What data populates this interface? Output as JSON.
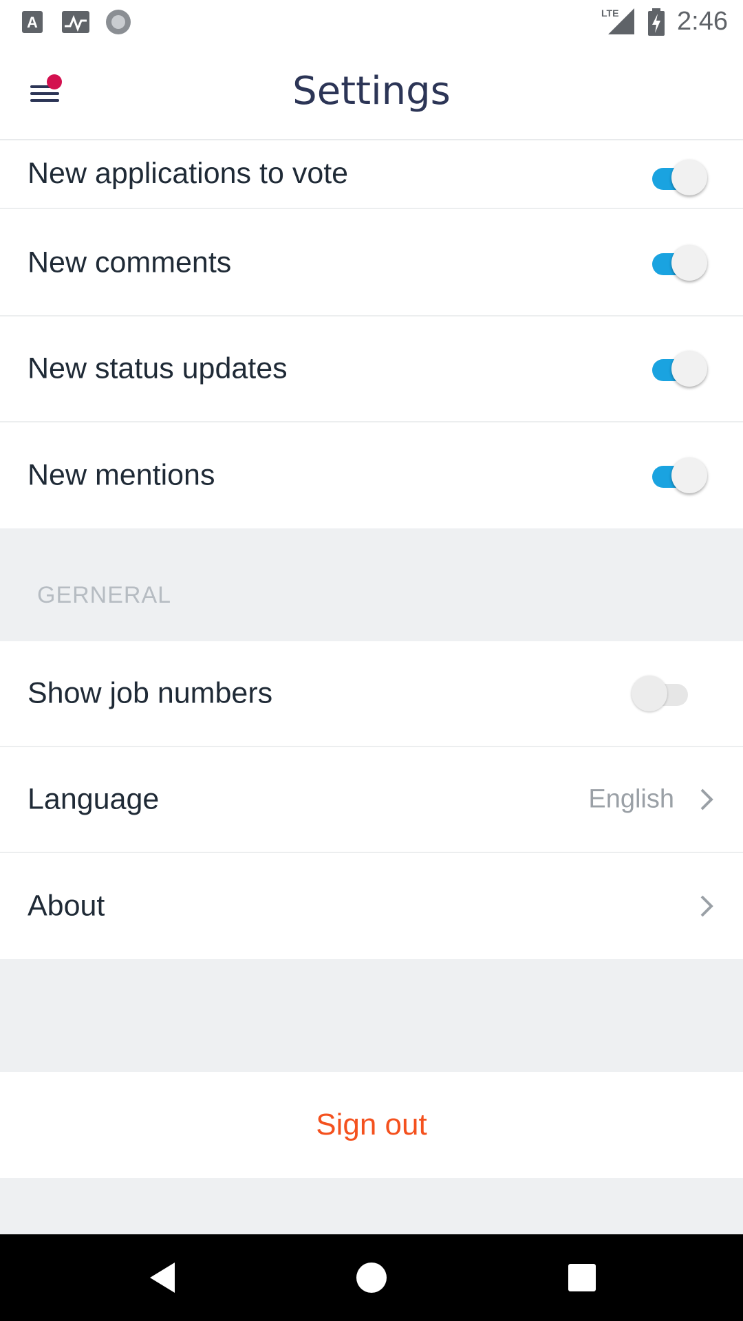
{
  "status_bar": {
    "time": "2:46",
    "network": "LTE",
    "left_icons": [
      "text-a-icon",
      "activity-icon",
      "record-icon"
    ],
    "right_icons": [
      "lte-signal-icon",
      "battery-charging-icon"
    ]
  },
  "app_bar": {
    "title": "Settings",
    "menu_icon": "hamburger-menu-icon",
    "notification_dot_color": "#d3104f"
  },
  "notifications": [
    {
      "label": "New applications to vote",
      "enabled": true
    },
    {
      "label": "New comments",
      "enabled": true
    },
    {
      "label": "New status updates",
      "enabled": true
    },
    {
      "label": "New mentions",
      "enabled": true
    }
  ],
  "general": {
    "header": "GERNERAL",
    "show_job_numbers": {
      "label": "Show job numbers",
      "enabled": false
    },
    "language": {
      "label": "Language",
      "value": "English"
    },
    "about": {
      "label": "About"
    }
  },
  "sign_out": {
    "label": "Sign out",
    "color": "#f4511e"
  },
  "colors": {
    "toggle_on": "#1aa3e0",
    "title": "#2c3556",
    "section_bg": "#eef0f2"
  },
  "nav_bar": {
    "icons": [
      "back-icon",
      "home-icon",
      "recents-icon"
    ]
  }
}
